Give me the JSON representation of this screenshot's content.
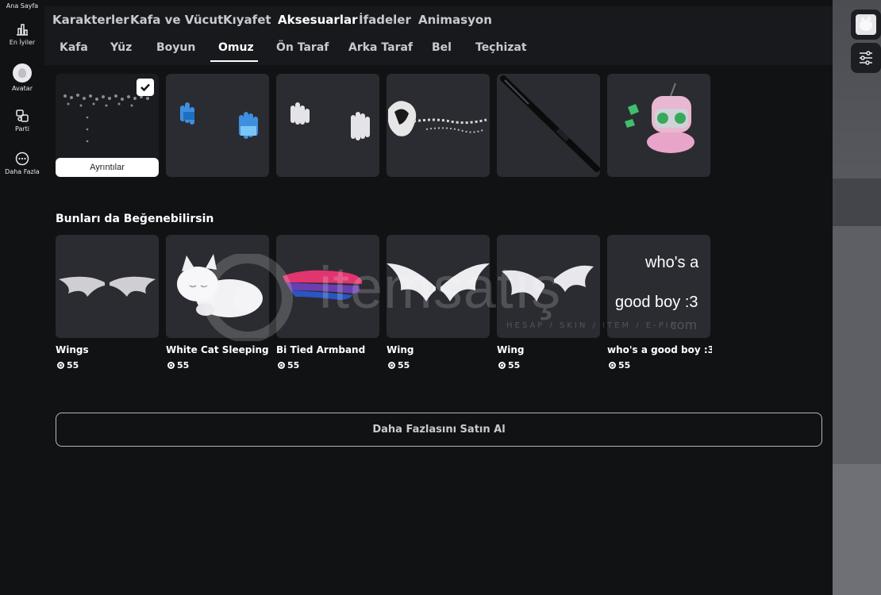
{
  "sidebar": {
    "items": [
      {
        "label": "Ana Sayfa",
        "icon": "home-icon"
      },
      {
        "label": "En İyiler",
        "icon": "chart-icon"
      },
      {
        "label": "Avatar",
        "icon": "avatar-icon"
      },
      {
        "label": "Parti",
        "icon": "party-icon"
      },
      {
        "label": "Daha Fazla",
        "icon": "more-icon"
      }
    ]
  },
  "topnav": {
    "tabs": [
      "Karakterler",
      "Kafa ve Vücut",
      "Kıyafet",
      "Aksesuarlar",
      "İfadeler",
      "Animasyon"
    ],
    "active": "Aksesuarlar"
  },
  "subnav": {
    "tabs": [
      "Kafa",
      "Yüz",
      "Boyun",
      "Omuz",
      "Ön Taraf",
      "Arka Taraf",
      "Bel",
      "Teçhizat"
    ],
    "active": "Omuz"
  },
  "owned": {
    "details_label": "Ayrıntılar"
  },
  "recommended": {
    "title": "Bunları da Beğenebilirsin",
    "items": [
      {
        "name": "Wings",
        "price": "55"
      },
      {
        "name": "White Cat Sleeping ...",
        "price": "55"
      },
      {
        "name": "Bi Tied Armband",
        "price": "55"
      },
      {
        "name": "Wing",
        "price": "55"
      },
      {
        "name": "Wing",
        "price": "55"
      },
      {
        "name": "who's a good boy :3 ...",
        "price": "55"
      }
    ],
    "speech_line1": "who's a",
    "speech_line2": "good boy :3"
  },
  "buy_more_label": "Daha Fazlasını Satın Al",
  "watermark": {
    "text": "itemsatış",
    "sub": "HESAP / SKIN / ITEM / E-PIN",
    "domain": "com"
  }
}
